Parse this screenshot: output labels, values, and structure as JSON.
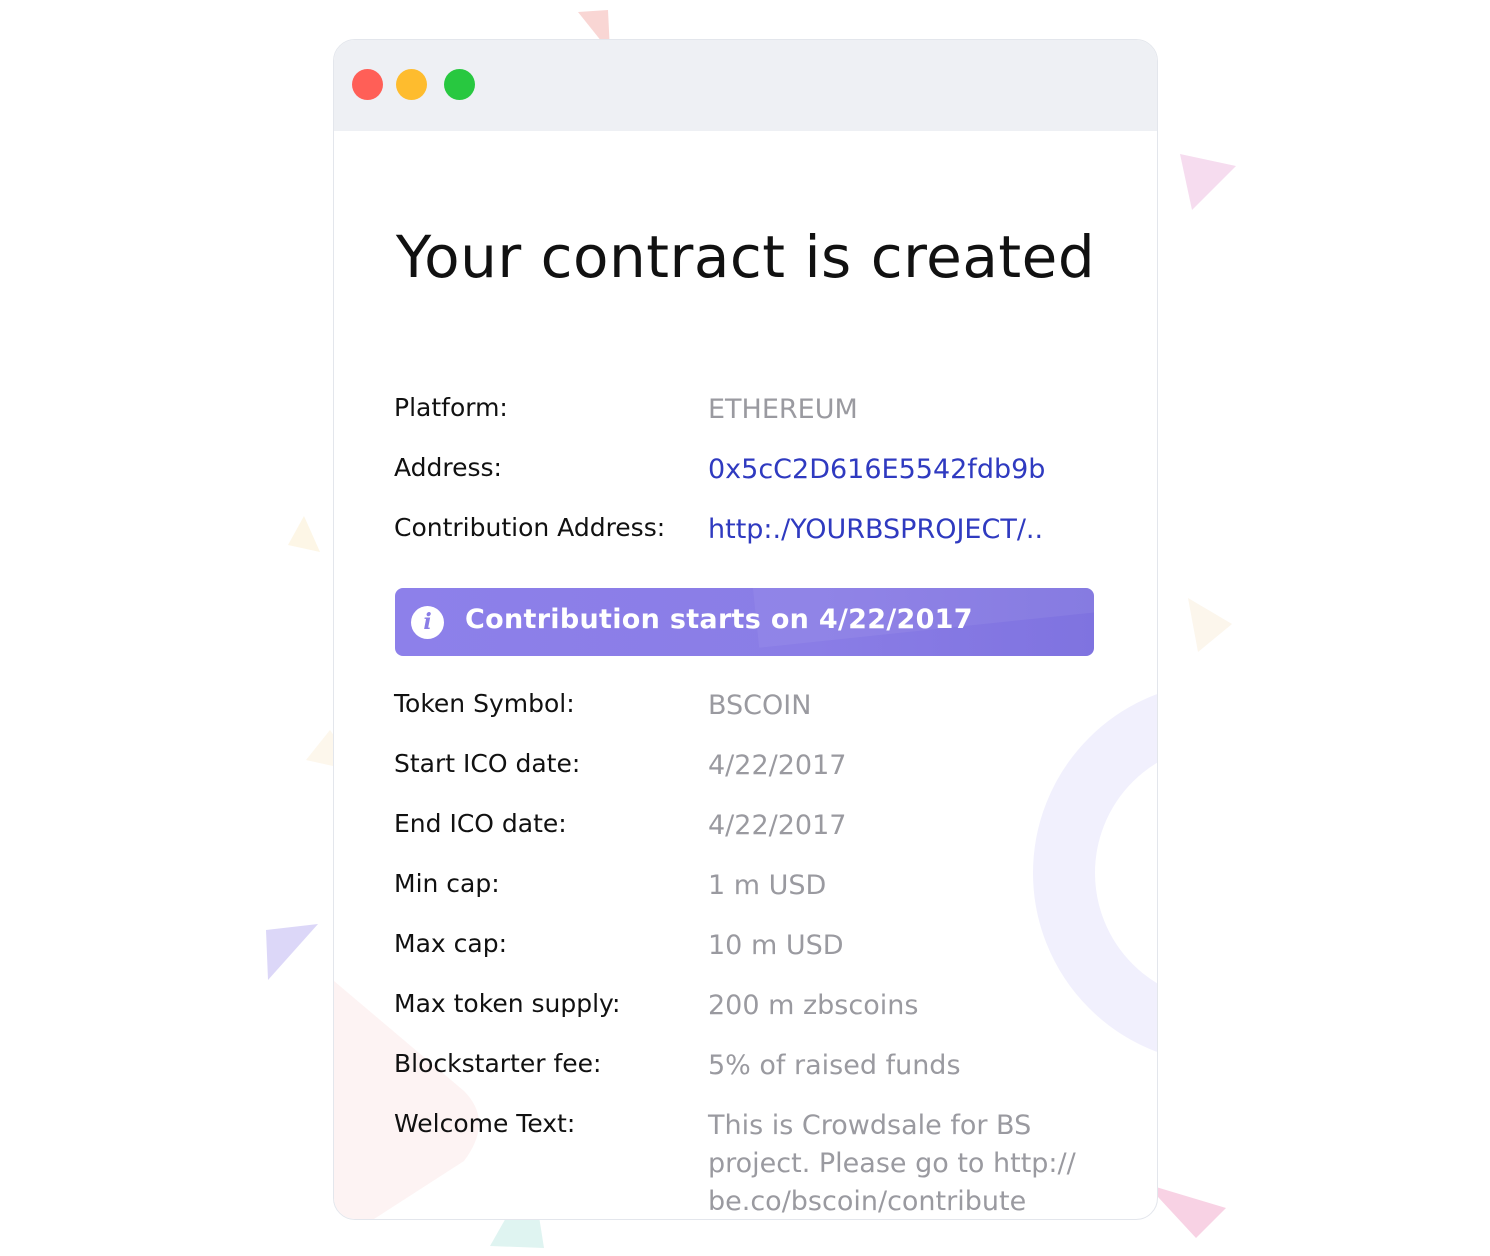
{
  "window": {
    "controls": [
      "close",
      "minimize",
      "maximize"
    ]
  },
  "title": "Your contract is created",
  "details_top": [
    {
      "label": "Platform:",
      "value": "ETHEREUM",
      "is_link": false
    },
    {
      "label": "Address:",
      "value": "0x5cC2D616E5542fdb9b",
      "is_link": true
    },
    {
      "label": "Contribution Address:",
      "value": "http:./YOURBSPROJECT/..",
      "is_link": true
    }
  ],
  "banner": {
    "icon": "info-icon",
    "text": "Contribution starts on 4/22/2017"
  },
  "details_bottom": [
    {
      "label": "Token Symbol:",
      "value": "BSCOIN"
    },
    {
      "label": "Start ICO date:",
      "value": "4/22/2017"
    },
    {
      "label": "End ICO date:",
      "value": "4/22/2017"
    },
    {
      "label": "Min cap:",
      "value": "1 m USD"
    },
    {
      "label": "Max cap:",
      "value": "10 m USD"
    },
    {
      "label": "Max token supply:",
      "value": "200 m zbscoins"
    },
    {
      "label": "Blockstarter fee:",
      "value": "5% of raised funds"
    },
    {
      "label": "Welcome Text:",
      "value": "This is Crowdsale for BS project. Please go to http:// be.co/bscoin/contribute"
    }
  ],
  "colors": {
    "accent": "#8a7de6",
    "link": "#2f3ac0",
    "value_text": "#9a9aa0",
    "close": "#ff5f57",
    "minimize": "#febc2e",
    "maximize": "#28c840"
  }
}
